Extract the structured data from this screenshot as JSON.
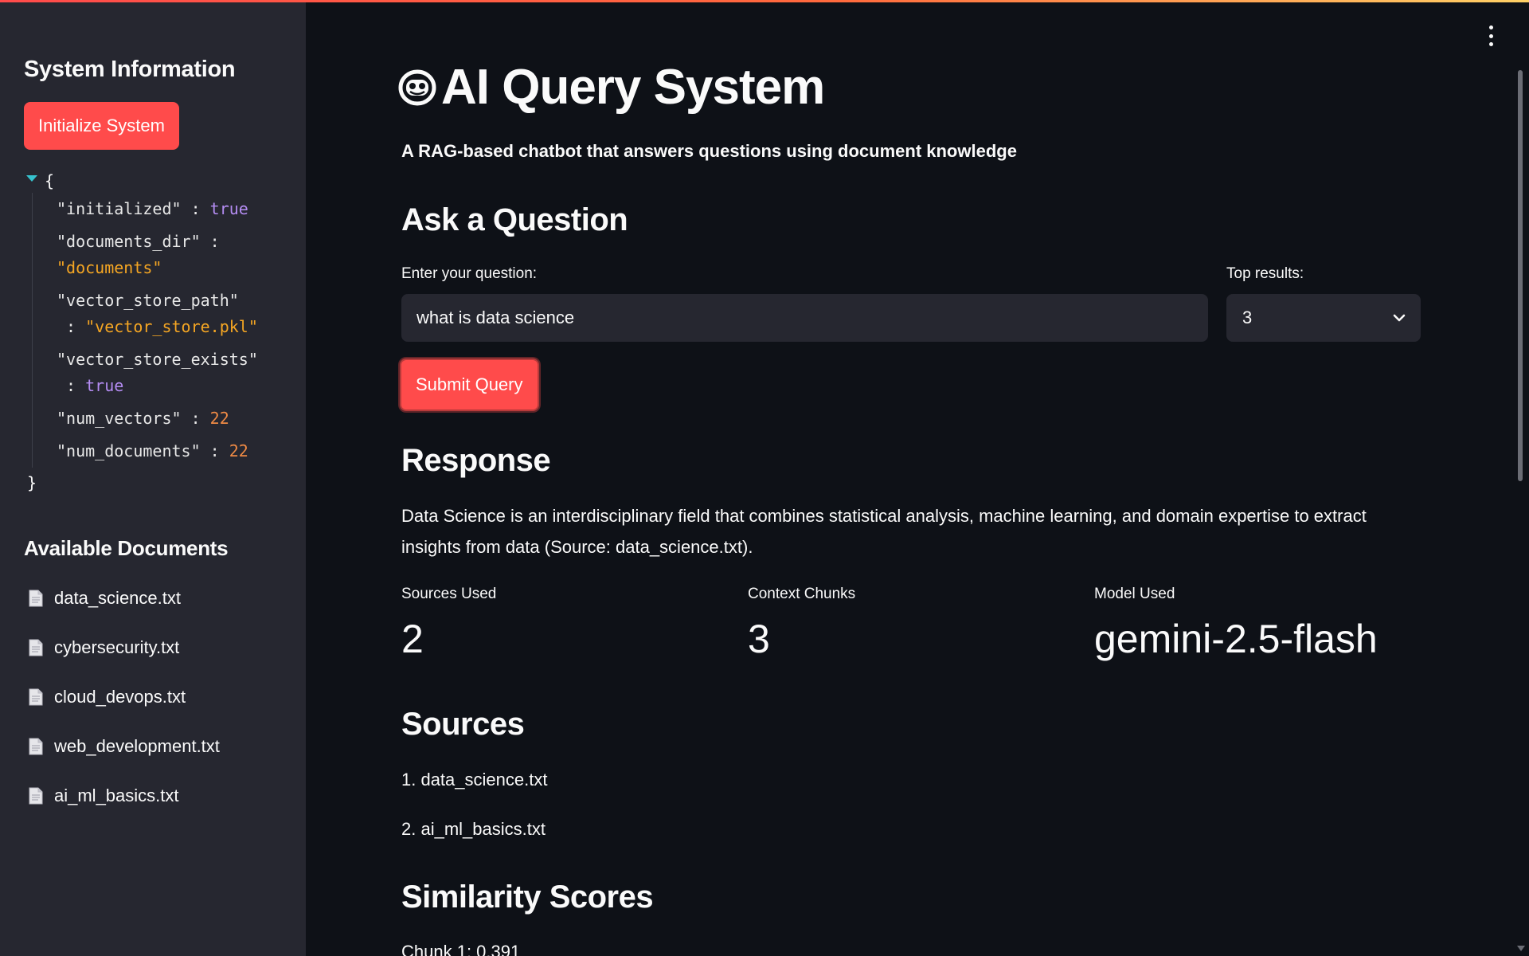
{
  "sidebar": {
    "title": "System Information",
    "init_button": "Initialize System",
    "json": {
      "open_brace": "{",
      "close_brace": "}",
      "rows": [
        {
          "key": "\"initialized\"",
          "value": "true",
          "type": "bool"
        },
        {
          "key": "\"documents_dir\"",
          "value": "\"documents\"",
          "type": "str"
        },
        {
          "key": "\"vector_store_path\"",
          "value": "\"vector_store.pkl\"",
          "type": "str"
        },
        {
          "key": "\"vector_store_exists\"",
          "value": "true",
          "type": "bool"
        },
        {
          "key": "\"num_vectors\"",
          "value": "22",
          "type": "num"
        },
        {
          "key": "\"num_documents\"",
          "value": "22",
          "type": "num"
        }
      ]
    },
    "docs_title": "Available Documents",
    "documents": [
      "data_science.txt",
      "cybersecurity.txt",
      "cloud_devops.txt",
      "web_development.txt",
      "ai_ml_basics.txt"
    ]
  },
  "main": {
    "title": "AI Query System",
    "subtitle": "A RAG-based chatbot that answers questions using document knowledge",
    "ask_heading": "Ask a Question",
    "question_label": "Enter your question:",
    "question_value": "what is data science",
    "top_results_label": "Top results:",
    "top_results_value": "3",
    "submit_button": "Submit Query",
    "response_heading": "Response",
    "response_text": "Data Science is an interdisciplinary field that combines statistical analysis, machine learning, and domain expertise to extract insights from data (Source: data_science.txt).",
    "metrics": [
      {
        "label": "Sources Used",
        "value": "2"
      },
      {
        "label": "Context Chunks",
        "value": "3"
      },
      {
        "label": "Model Used",
        "value": "gemini-2.5-flash"
      }
    ],
    "sources_heading": "Sources",
    "sources": [
      "1. data_science.txt",
      "2. ai_ml_basics.txt"
    ],
    "similarity_heading": "Similarity Scores",
    "chunk_line": "Chunk 1: 0.391"
  },
  "colors": {
    "background": "#0e1117",
    "sidebar": "#262730",
    "accent": "#ff4b4b",
    "json_bool": "#b48cf2",
    "json_string": "#f5a623",
    "json_number": "#ee8a45"
  },
  "icons": {
    "title_icon": "robot-face-icon",
    "doc_icon": "page-icon",
    "menu_icon": "vertical-dots-icon",
    "select_icon": "chevron-down-icon",
    "json_toggle": "caret-down-icon"
  }
}
